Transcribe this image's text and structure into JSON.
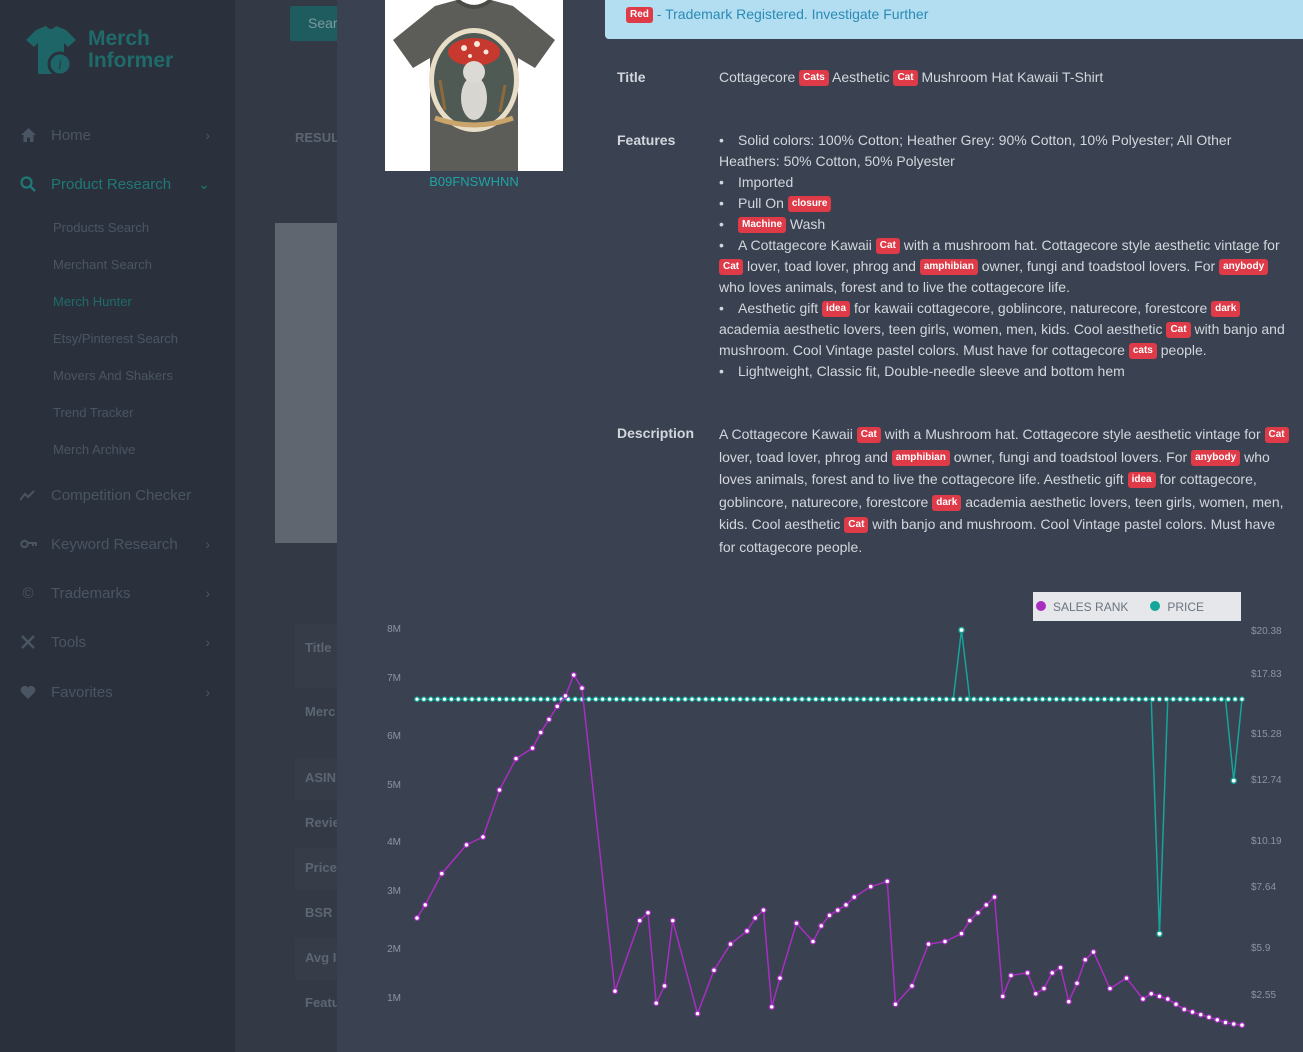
{
  "app": {
    "logo_line1": "Merch",
    "logo_line2": "Informer",
    "colors": {
      "accent": "#1f7878",
      "sidebar": "#2b313c",
      "badge": "#de3a48",
      "rank_series": "#a82ec2",
      "price_series": "#15a59a"
    }
  },
  "sidebar": {
    "items": [
      {
        "label": "Home",
        "icon": "home-icon"
      },
      {
        "label": "Product Research",
        "icon": "search-icon"
      },
      {
        "label": "Competition Checker",
        "icon": "trend-icon"
      },
      {
        "label": "Keyword Research",
        "icon": "key-icon"
      },
      {
        "label": "Trademarks",
        "icon": "copyright-icon"
      },
      {
        "label": "Tools",
        "icon": "tools-icon"
      },
      {
        "label": "Favorites",
        "icon": "heart-icon"
      }
    ],
    "sub_items": [
      "Products Search",
      "Merchant Search",
      "Merch Hunter",
      "Etsy/Pinterest Search",
      "Movers And Shakers",
      "Trend Tracker",
      "Merch Archive"
    ]
  },
  "background": {
    "search_button": "Sear",
    "results_label": "RESUL",
    "fields": [
      "Title",
      "Merc",
      "ASIN",
      "Revie",
      "Price",
      "BSR",
      "Avg I",
      "Featu"
    ]
  },
  "product": {
    "asin": "B09FNSWHNN",
    "trademark_badge": "Red",
    "trademark_text": " - Trademark Registered. Investigate Further",
    "labels": {
      "title": "Title",
      "features": "Features",
      "description": "Description"
    },
    "title": {
      "t1": "Cottagecore ",
      "b1": "Cats",
      "t2": " Aesthetic ",
      "b2": "Cat",
      "t3": " Mushroom Hat Kawaii T-Shirt"
    },
    "features": {
      "f1": "Solid colors: 100% Cotton; Heather Grey: 90% Cotton, 10% Polyester; All Other Heathers: 50% Cotton, 50% Polyester",
      "f2": "Imported",
      "f3_t1": "Pull On ",
      "f3_b1": "closure",
      "f4_b1": "Machine",
      "f4_t1": " Wash",
      "f5_t1": "A Cottagecore Kawaii ",
      "f5_b1": "Cat",
      "f5_t2": " with a mushroom hat. Cottagecore style aesthetic vintage for ",
      "f5_b2": "Cat",
      "f5_t3": " lover, toad lover, phrog and ",
      "f5_b3": "amphibian",
      "f5_t4": " owner, fungi and toadstool lovers. For ",
      "f5_b4": "anybody",
      "f5_t5": " who loves animals, forest and to live the cottagecore life.",
      "f6_t1": "Aesthetic gift ",
      "f6_b1": "idea",
      "f6_t2": " for kawaii cottagecore, goblincore, naturecore, forestcore ",
      "f6_b2": "dark",
      "f6_t3": " academia aesthetic lovers, teen girls, women, men, kids. Cool aesthetic ",
      "f6_b3": "Cat",
      "f6_t4": " with banjo and mushroom. Cool Vintage pastel colors. Must have for cottagecore ",
      "f6_b4": "cats",
      "f6_t5": " people.",
      "f7": "Lightweight, Classic fit, Double-needle sleeve and bottom hem"
    },
    "description": {
      "t1": "A Cottagecore Kawaii ",
      "b1": "Cat",
      "t2": " with a Mushroom hat. Cottagecore style aesthetic vintage for ",
      "b2": "Cat",
      "t3": " lover, toad lover, phrog and ",
      "b3": "amphibian",
      "t4": " owner, fungi and toadstool lovers. For ",
      "b4": "anybody",
      "t5": " who loves animals, forest and to live the cottagecore life. Aesthetic gift ",
      "b5": "idea",
      "t6": " for cottagecore, goblincore, naturecore, forestcore ",
      "b6": "dark",
      "t7": " academia aesthetic lovers, teen girls, women, men, kids. Cool aesthetic ",
      "b7": "Cat",
      "t8": " with banjo and mushroom. Cool Vintage pastel colors. Must have for cottagecore people."
    }
  },
  "chart_data": {
    "type": "line",
    "legend": [
      "SALES RANK",
      "PRICE"
    ],
    "legend_position": "top-right",
    "y_left_ticks": [
      "8M",
      "7M",
      "6M",
      "5M",
      "4M",
      "3M",
      "2M",
      "1M"
    ],
    "y_right_ticks": [
      "$20.38",
      "$17.83",
      "$15.28",
      "$12.74",
      "$10.19",
      "$7.64",
      "$5.9",
      "$2.55"
    ],
    "ylim_left": [
      0,
      8000000
    ],
    "series": [
      {
        "name": "SALES RANK",
        "color": "#a82ec2",
        "x": [
          0,
          1,
          3,
          6,
          8,
          10,
          12,
          14,
          15,
          16,
          17,
          18,
          19,
          20,
          24,
          27,
          28,
          29,
          30,
          31,
          34,
          36,
          38,
          40,
          41,
          42,
          43,
          44,
          46,
          48,
          49,
          50,
          51,
          52,
          53,
          55,
          57,
          58,
          60,
          62,
          64,
          66,
          67,
          68,
          69,
          70,
          71,
          72,
          74,
          75,
          76,
          77,
          78,
          79,
          80,
          81,
          82,
          84,
          86,
          88,
          89,
          90,
          91,
          92,
          93,
          94,
          95,
          96,
          97,
          98,
          99,
          100
        ],
        "values": [
          2450000,
          2700000,
          3300000,
          3850000,
          4000000,
          4900000,
          5500000,
          5700000,
          6000000,
          6250000,
          6500000,
          6700000,
          7100000,
          6850000,
          1050000,
          2400000,
          2550000,
          820000,
          1150000,
          2400000,
          620000,
          1450000,
          1950000,
          2200000,
          2450000,
          2600000,
          750000,
          1300000,
          2350000,
          2000000,
          2300000,
          2500000,
          2600000,
          2700000,
          2850000,
          3050000,
          3150000,
          800000,
          1150000,
          1950000,
          2000000,
          2150000,
          2400000,
          2550000,
          2700000,
          2850000,
          950000,
          1350000,
          1400000,
          1000000,
          1100000,
          1400000,
          1500000,
          850000,
          1200000,
          1650000,
          1800000,
          1100000,
          1300000,
          900000,
          1000000,
          950000,
          900000,
          800000,
          700000,
          650000,
          600000,
          550000,
          500000,
          450000,
          420000,
          400000
        ]
      },
      {
        "name": "PRICE",
        "color": "#15a59a",
        "x": [
          0,
          65,
          66,
          67,
          89,
          90,
          91,
          98,
          99,
          100
        ],
        "values": [
          16.99,
          16.99,
          20.38,
          16.99,
          16.99,
          5.5,
          16.99,
          16.99,
          13.0,
          16.99
        ]
      }
    ],
    "ylim_right": [
      2.55,
      20.38
    ]
  }
}
